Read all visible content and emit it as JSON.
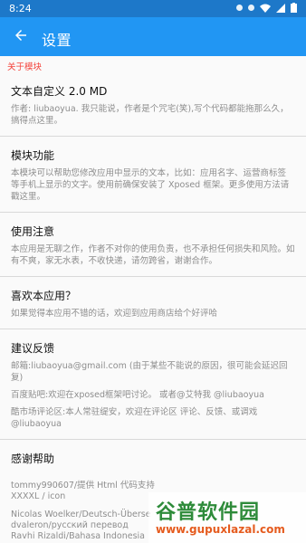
{
  "status": {
    "time": "8:24"
  },
  "appbar": {
    "title": "设置"
  },
  "section": {
    "header": "关于模块"
  },
  "items": [
    {
      "title": "文本自定义 2.0 MD",
      "desc": "作者: liubaoyua. 我只能说，作者是个咒宅(笑),写个代码都能拖那么久，搞得点这里。"
    },
    {
      "title": "模块功能",
      "desc": "本模块可以帮助您修改应用中显示的文本，比如：应用名字、运营商标签 等手机上显示的文字。使用前确保安装了 Xposed 框架。更多使用方法请戳这里。"
    },
    {
      "title": "使用注意",
      "desc": "本应用是无聊之作，作者不对你的使用负责，也不承担任何损失和风险。如有不爽，家无水表，不收快递，请勿跨省，谢谢合作。"
    },
    {
      "title": "喜欢本应用？",
      "desc": "如果觉得本应用不错的话，欢迎到应用商店给个好评哈"
    }
  ],
  "feedback": {
    "title": "建议反馈",
    "email": "邮箱:liubaoyua@gmail.com (由于某些不能说的原因，很可能会延迟回复)",
    "tieba": "百度贴吧:欢迎在xposed框架吧讨论。 或者@艾特我 @liubaoyua",
    "coolapk": "酷市场评论区:本人常驻缇安，欢迎在评论区 评论、反馈、或调戏 @liubaoyua"
  },
  "thanks": {
    "title": "感谢帮助",
    "lines": [
      "tommy990607/提供 Html 代码支持",
      "XXXXL / icon",
      "",
      "Nicolas Woelker/Deutsch-Überse",
      "dvaleron/русский перевод",
      "Ravhi Rizaldi/Bahasa Indonesia"
    ]
  },
  "watermark": {
    "brand": "谷普软件园",
    "url": "www.gupuxlazal.com"
  }
}
